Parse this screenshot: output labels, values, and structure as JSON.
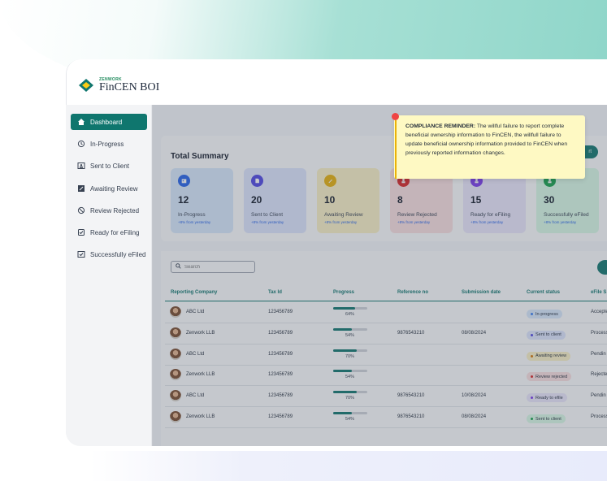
{
  "app": {
    "logo_small": "ZENWORK",
    "logo_big": "FinCEN BOI"
  },
  "sidebar": {
    "items": [
      {
        "label": "Dashboard",
        "icon": "home-icon",
        "active": true
      },
      {
        "label": "In-Progress",
        "icon": "clock-icon",
        "active": false
      },
      {
        "label": "Sent to Client",
        "icon": "user-card-icon",
        "active": false
      },
      {
        "label": "Awaiting Review",
        "icon": "pen-icon",
        "active": false
      },
      {
        "label": "Review Rejected",
        "icon": "ban-icon",
        "active": false
      },
      {
        "label": "Ready for eFiling",
        "icon": "check-square-icon",
        "active": false
      },
      {
        "label": "Successfully eFiled",
        "icon": "doc-check-icon",
        "active": false
      }
    ]
  },
  "summary": {
    "title": "Total Summary",
    "export_label": "rt",
    "stats": [
      {
        "value": "12",
        "label": "In-Progress",
        "sub": "+8% from yesterday",
        "bg": "#dbeafe",
        "icon_bg": "#2563eb",
        "icon": "calendar-icon"
      },
      {
        "value": "20",
        "label": "Sent to Client",
        "sub": "+8% from yesterday",
        "bg": "#e0e7ff",
        "icon_bg": "#4f46e5",
        "icon": "document-icon"
      },
      {
        "value": "10",
        "label": "Awaiting Review",
        "sub": "+8% from yesterday",
        "bg": "#fef3c7",
        "icon_bg": "#eab308",
        "icon": "pencil-icon"
      },
      {
        "value": "8",
        "label": "Review Rejected",
        "sub": "+8% from yesterday",
        "bg": "#fee2e2",
        "icon_bg": "#dc2626",
        "icon": "user-x-icon"
      },
      {
        "value": "15",
        "label": "Ready for eFiling",
        "sub": "+8% from yesterday",
        "bg": "#ede9fe",
        "icon_bg": "#7c3aed",
        "icon": "user-icon"
      },
      {
        "value": "30",
        "label": "Successfully eFiled",
        "sub": "+8% from yesterday",
        "bg": "#dcfce7",
        "icon_bg": "#16a34a",
        "icon": "user-check-icon"
      }
    ]
  },
  "search": {
    "placeholder": "Search"
  },
  "table": {
    "headers": [
      "Reporting Company",
      "Tax Id",
      "Progress",
      "Reference no",
      "Submission date",
      "Current status",
      "eFile S"
    ],
    "rows": [
      {
        "company": "ABC Ltd",
        "tax_id": "123456789",
        "progress": 0.64,
        "progress_label": "64%",
        "reference": "",
        "date": "",
        "status": "In-progress",
        "status_color": "#3b82f6",
        "status_bg": "#dbeafe",
        "efile": "Accepte"
      },
      {
        "company": "Zenwork LLB",
        "tax_id": "123456789",
        "progress": 0.54,
        "progress_label": "54%",
        "reference": "9876543210",
        "date": "08/08/2024",
        "status": "Sent to client",
        "status_color": "#4f46e5",
        "status_bg": "#e0e7ff",
        "efile": "Process"
      },
      {
        "company": "ABC Ltd",
        "tax_id": "123456789",
        "progress": 0.7,
        "progress_label": "70%",
        "reference": "",
        "date": "",
        "status": "Awaiting review",
        "status_color": "#d97706",
        "status_bg": "#fef3c7",
        "efile": "Pendin"
      },
      {
        "company": "Zenwork LLB",
        "tax_id": "123456789",
        "progress": 0.54,
        "progress_label": "54%",
        "reference": "",
        "date": "",
        "status": "Review rejected",
        "status_color": "#dc2626",
        "status_bg": "#fee2e2",
        "efile": "Rejecte"
      },
      {
        "company": "ABC Ltd",
        "tax_id": "123456789",
        "progress": 0.7,
        "progress_label": "70%",
        "reference": "9876543210",
        "date": "10/08/2024",
        "status": "Ready to efile",
        "status_color": "#7c3aed",
        "status_bg": "#ede9fe",
        "efile": "Pendin"
      },
      {
        "company": "Zenwork LLB",
        "tax_id": "123456789",
        "progress": 0.54,
        "progress_label": "54%",
        "reference": "9876543210",
        "date": "08/08/2024",
        "status": "Sent to client",
        "status_color": "#16a34a",
        "status_bg": "#dcfce7",
        "efile": "Process"
      }
    ]
  },
  "tooltip": {
    "heading": "COMPLIANCE REMINDER:",
    "body": "The willful failure to report complete beneficial ownership information to FinCEN, the willfull failure to update beneficial ownership information provided to FinCEN when previously reported information changes."
  }
}
